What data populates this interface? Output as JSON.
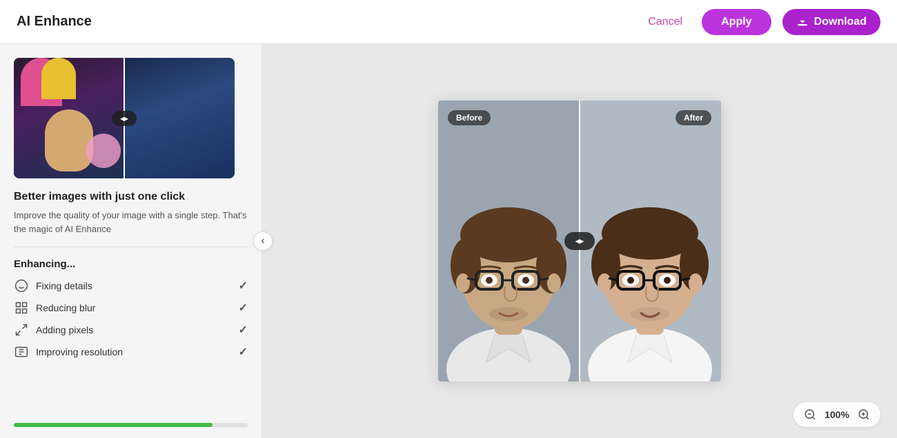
{
  "header": {
    "title": "AI Enhance",
    "cancel_label": "Cancel",
    "apply_label": "Apply",
    "download_label": "Download"
  },
  "left_panel": {
    "promo_title": "Better images with just one click",
    "promo_desc": "Improve the quality of your image with a single step. That's the magic of AI Enhance",
    "enhancing_title": "Enhancing...",
    "steps": [
      {
        "label": "Fixing details",
        "icon": "smile-icon",
        "done": true
      },
      {
        "label": "Reducing blur",
        "icon": "grid-icon",
        "done": true
      },
      {
        "label": "Adding pixels",
        "icon": "expand-icon",
        "done": true
      },
      {
        "label": "Improving resolution",
        "icon": "resolution-icon",
        "done": true
      }
    ],
    "progress_percent": 85
  },
  "compare": {
    "before_label": "Before",
    "after_label": "After"
  },
  "zoom": {
    "level": "100%",
    "zoom_in_label": "+",
    "zoom_out_label": "−"
  }
}
